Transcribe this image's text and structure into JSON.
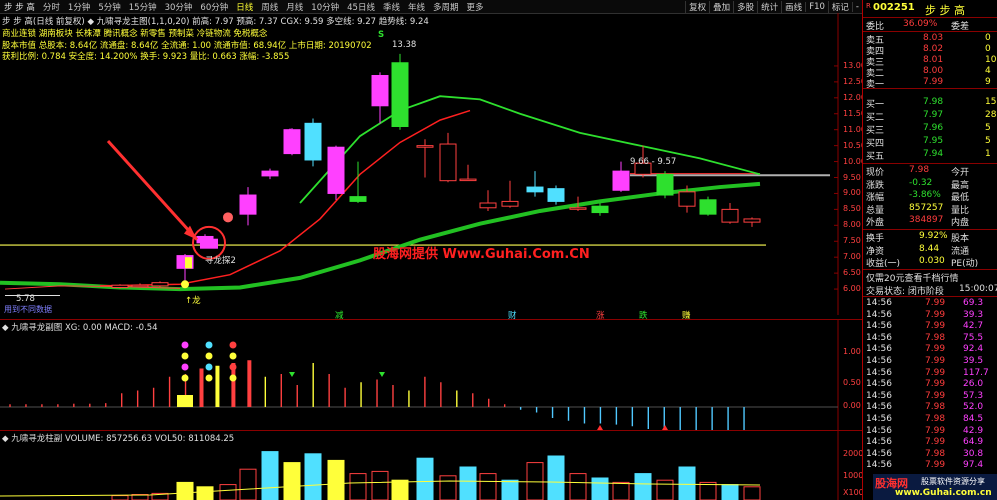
{
  "toolbar": {
    "app_name": "步 步 高",
    "periods": [
      "分时",
      "1分钟",
      "5分钟",
      "15分钟",
      "30分钟",
      "60分钟",
      "日线",
      "周线",
      "月线",
      "10分钟",
      "45日线",
      "季线",
      "年线",
      "多周期",
      "更多"
    ],
    "active_period": "日线",
    "buttons": [
      "复权",
      "叠加",
      "多股",
      "统计",
      "画线",
      "F10",
      "标记",
      "-"
    ]
  },
  "main_header": {
    "line1": "步 步 高(日线 前复权)  ◆ 九啸寻龙主图(1,1,0,20)  前高: 7.97  预高: 7.37  CGX: 9.59  多空线: 9.27  趋势线: 9.24",
    "line2": "商业连锁 湖南板块   长株潭  腾讯概念  新零售  预制菜  冷链物流  免税概念",
    "line3": "股本市值 总股本: 8.64亿  流通盘: 8.64亿  全流通: 1.00  流通市值: 68.94亿  上市日期: 20190702",
    "line4": "获利比例: 0.784    安全度: 14.200%     换手: 9.923   量比: 0.663   涨幅: -3.855"
  },
  "main_annotations": {
    "high_price": "13.38",
    "range_label": "9.66 - 9.57",
    "low_price": "5.78",
    "low_note": "用到不同数据",
    "dragon_label": "寻龙探2",
    "dragon_side": "↑龙",
    "s_mark": "S",
    "watermark": "股海网提供 Www.Guhai.Com.CN",
    "bottom_tags": [
      "减",
      "财",
      "涨",
      "跌",
      "赚"
    ]
  },
  "main_axis": {
    "ticks": [
      "13.00",
      "12.50",
      "12.00",
      "11.50",
      "11.00",
      "10.50",
      "10.00",
      "9.50",
      "9.00",
      "8.50",
      "8.00",
      "7.50",
      "7.00",
      "6.50",
      "6.00"
    ]
  },
  "macd_panel": {
    "header": "◆ 九啸寻龙副图  XG: 0.00  MACD: -0.54",
    "ticks": [
      "1.00",
      "0.50",
      "0.00"
    ]
  },
  "volume_panel": {
    "header": "◆ 九啸寻龙柱副  VOLUME: 857256.63  VOL50: 811084.25",
    "ticks": [
      "20000",
      "10000",
      "X1000"
    ]
  },
  "right_panel": {
    "code": "002251",
    "name": "步 步 高",
    "weibi": {
      "label": "委比",
      "value": "36.09%",
      "label2": "委差",
      "value2": ""
    },
    "asks": [
      {
        "label": "卖五",
        "price": "8.03",
        "vol": "0"
      },
      {
        "label": "卖四",
        "price": "8.02",
        "vol": "0"
      },
      {
        "label": "卖三",
        "price": "8.01",
        "vol": "10"
      },
      {
        "label": "卖二",
        "price": "8.00",
        "vol": "4"
      },
      {
        "label": "卖一",
        "price": "7.99",
        "vol": "9"
      }
    ],
    "bids": [
      {
        "label": "买一",
        "price": "7.98",
        "vol": "15"
      },
      {
        "label": "买二",
        "price": "7.97",
        "vol": "28"
      },
      {
        "label": "买三",
        "price": "7.96",
        "vol": "5"
      },
      {
        "label": "买四",
        "price": "7.95",
        "vol": "5"
      },
      {
        "label": "买五",
        "price": "7.94",
        "vol": "1"
      }
    ],
    "quote": [
      {
        "l1": "现价",
        "v1": "7.98",
        "l2": "今开",
        "v2": ""
      },
      {
        "l1": "涨跌",
        "v1": "-0.32",
        "l2": "最高",
        "v2": ""
      },
      {
        "l1": "涨幅",
        "v1": "-3.86%",
        "l2": "最低",
        "v2": ""
      },
      {
        "l1": "总量",
        "v1": "857257",
        "l2": "量比",
        "v2": ""
      },
      {
        "l1": "外盘",
        "v1": "384897",
        "l2": "内盘",
        "v2": ""
      }
    ],
    "fin": [
      {
        "l1": "换手",
        "v1": "9.92%",
        "l2": "股本",
        "v2": ""
      },
      {
        "l1": "净资",
        "v1": "8.44",
        "l2": "流通",
        "v2": ""
      },
      {
        "l1": "收益(一)",
        "v1": "0.030",
        "l2": "PE(动)",
        "v2": ""
      }
    ],
    "ad": "仅需20元查看千档行情",
    "status_label": "交易状态: 闭市阶段",
    "status_time": "15:00:07",
    "ticks": [
      {
        "t": "14:56",
        "p": "7.99",
        "v": "69.3"
      },
      {
        "t": "14:56",
        "p": "7.99",
        "v": "39.3"
      },
      {
        "t": "14:56",
        "p": "7.99",
        "v": "42.7"
      },
      {
        "t": "14:56",
        "p": "7.98",
        "v": "75.5"
      },
      {
        "t": "14:56",
        "p": "7.99",
        "v": "92.4"
      },
      {
        "t": "14:56",
        "p": "7.99",
        "v": "39.5"
      },
      {
        "t": "14:56",
        "p": "7.99",
        "v": "117.7"
      },
      {
        "t": "14:56",
        "p": "7.99",
        "v": "26.0"
      },
      {
        "t": "14:56",
        "p": "7.99",
        "v": "57.3"
      },
      {
        "t": "14:56",
        "p": "7.98",
        "v": "52.0"
      },
      {
        "t": "14:56",
        "p": "7.98",
        "v": "84.5"
      },
      {
        "t": "14:56",
        "p": "7.99",
        "v": "42.9"
      },
      {
        "t": "14:56",
        "p": "7.99",
        "v": "64.9"
      },
      {
        "t": "14:56",
        "p": "7.98",
        "v": "30.8"
      },
      {
        "t": "14:56",
        "p": "7.99",
        "v": "97.4"
      }
    ],
    "brand": "股海网",
    "brand_sub": "股票软件资源分享",
    "brand_url": "www.Guhai.com.cn"
  },
  "colors": {
    "up": "#ff3d3d",
    "down": "#2ee02e",
    "bg": "#000000",
    "ma": "#ff2020",
    "trend": "#22c022",
    "yellow_line": "#ffff55"
  },
  "candles": [
    {
      "o": 6.05,
      "c": 6.12,
      "h": 6.15,
      "l": 6.02,
      "col": "#ff4040"
    },
    {
      "o": 6.12,
      "c": 6.1,
      "h": 6.18,
      "l": 6.06,
      "col": "#ff4040"
    },
    {
      "o": 6.1,
      "c": 6.2,
      "h": 6.24,
      "l": 6.06,
      "col": "#ff4040"
    },
    {
      "o": 6.65,
      "c": 7.05,
      "h": 7.1,
      "l": 6.2,
      "col": "#ff40ff"
    },
    {
      "o": 7.45,
      "c": 7.65,
      "h": 7.72,
      "l": 7.35,
      "col": "#ff40ff"
    },
    {
      "o": 8.35,
      "c": 8.95,
      "h": 9.2,
      "l": 8.0,
      "col": "#ff40ff"
    },
    {
      "o": 9.55,
      "c": 9.7,
      "h": 9.78,
      "l": 9.45,
      "col": "#ff40ff"
    },
    {
      "o": 10.25,
      "c": 11.0,
      "h": 11.05,
      "l": 10.2,
      "col": "#ff40ff"
    },
    {
      "o": 11.2,
      "c": 10.05,
      "h": 11.35,
      "l": 9.85,
      "col": "#50e0ff"
    },
    {
      "o": 9.0,
      "c": 10.45,
      "h": 10.5,
      "l": 8.8,
      "col": "#ff40ff"
    },
    {
      "o": 8.9,
      "c": 8.75,
      "h": 10.0,
      "l": 8.7,
      "col": "#2ee02e"
    },
    {
      "o": 11.75,
      "c": 12.7,
      "h": 12.8,
      "l": 11.2,
      "col": "#ff40ff"
    },
    {
      "o": 13.1,
      "c": 11.1,
      "h": 13.38,
      "l": 11.0,
      "col": "#2ee02e"
    },
    {
      "o": 10.45,
      "c": 10.5,
      "h": 10.7,
      "l": 9.5,
      "col": "#ff4040"
    },
    {
      "o": 9.4,
      "c": 10.55,
      "h": 10.9,
      "l": 9.35,
      "col": "#ff4040"
    },
    {
      "o": 9.45,
      "c": 9.45,
      "h": 9.9,
      "l": 9.4,
      "col": "#ff4040"
    },
    {
      "o": 8.55,
      "c": 8.7,
      "h": 9.1,
      "l": 8.45,
      "col": "#ff4040"
    },
    {
      "o": 8.75,
      "c": 8.6,
      "h": 9.4,
      "l": 8.55,
      "col": "#ff4040"
    },
    {
      "o": 9.05,
      "c": 9.2,
      "h": 9.7,
      "l": 8.9,
      "col": "#50e0ff"
    },
    {
      "o": 9.15,
      "c": 8.75,
      "h": 9.25,
      "l": 8.65,
      "col": "#50e0ff"
    },
    {
      "o": 8.55,
      "c": 8.55,
      "h": 8.9,
      "l": 8.45,
      "col": "#ff4040"
    },
    {
      "o": 8.6,
      "c": 8.4,
      "h": 8.7,
      "l": 8.3,
      "col": "#2ee02e"
    },
    {
      "o": 9.1,
      "c": 9.7,
      "h": 10.0,
      "l": 9.05,
      "col": "#ff40ff"
    },
    {
      "o": 9.6,
      "c": 9.95,
      "h": 10.5,
      "l": 9.5,
      "col": "#ff4040"
    },
    {
      "o": 9.6,
      "c": 8.95,
      "h": 9.7,
      "l": 8.85,
      "col": "#2ee02e"
    },
    {
      "o": 9.05,
      "c": 8.6,
      "h": 9.25,
      "l": 8.4,
      "col": "#ff4040"
    },
    {
      "o": 8.8,
      "c": 8.35,
      "h": 8.9,
      "l": 8.3,
      "col": "#2ee02e"
    },
    {
      "o": 8.5,
      "c": 8.1,
      "h": 8.7,
      "l": 8.05,
      "col": "#ff4040"
    },
    {
      "o": 8.2,
      "c": 8.1,
      "h": 8.25,
      "l": 7.95,
      "col": "#ff4040"
    },
    {
      "o": 8.3,
      "c": 7.98,
      "h": 8.35,
      "l": 7.95,
      "col": "#50e0ff"
    }
  ],
  "macd_bars": [
    0.05,
    0.05,
    0.05,
    0.05,
    0.06,
    0.06,
    0.07,
    0.25,
    0.3,
    0.35,
    0.55,
    0.6,
    0.7,
    0.75,
    0.8,
    0.85,
    0.55,
    0.6,
    0.4,
    0.8,
    0.6,
    0.35,
    0.45,
    0.5,
    0.4,
    0.3,
    0.55,
    0.45,
    0.3,
    0.25,
    0.15,
    0.05,
    -0.05,
    -0.1,
    -0.2,
    -0.25,
    -0.3,
    -0.3,
    -0.32,
    -0.35,
    -0.4,
    -0.42,
    -0.45,
    -0.48,
    -0.5,
    -0.52,
    -0.54
  ],
  "volume_bars": [
    {
      "v": 2000,
      "col": "#ff4040"
    },
    {
      "v": 2500,
      "col": "#ff4040"
    },
    {
      "v": 3000,
      "col": "#ff4040"
    },
    {
      "v": 8000,
      "col": "#ffff3a"
    },
    {
      "v": 6000,
      "col": "#ffff3a"
    },
    {
      "v": 7000,
      "col": "#ff4040"
    },
    {
      "v": 14000,
      "col": "#ff4040"
    },
    {
      "v": 22000,
      "col": "#50e0ff"
    },
    {
      "v": 17000,
      "col": "#ffff3a"
    },
    {
      "v": 21000,
      "col": "#50e0ff"
    },
    {
      "v": 18000,
      "col": "#ffff3a"
    },
    {
      "v": 12000,
      "col": "#ff4040"
    },
    {
      "v": 13000,
      "col": "#ff4040"
    },
    {
      "v": 9000,
      "col": "#ffff3a"
    },
    {
      "v": 19000,
      "col": "#50e0ff"
    },
    {
      "v": 11000,
      "col": "#ff4040"
    },
    {
      "v": 15000,
      "col": "#50e0ff"
    },
    {
      "v": 12000,
      "col": "#ff4040"
    },
    {
      "v": 9000,
      "col": "#50e0ff"
    },
    {
      "v": 17000,
      "col": "#ff4040"
    },
    {
      "v": 20000,
      "col": "#50e0ff"
    },
    {
      "v": 12000,
      "col": "#ff4040"
    },
    {
      "v": 10000,
      "col": "#50e0ff"
    },
    {
      "v": 8000,
      "col": "#ff4040"
    }
  ]
}
